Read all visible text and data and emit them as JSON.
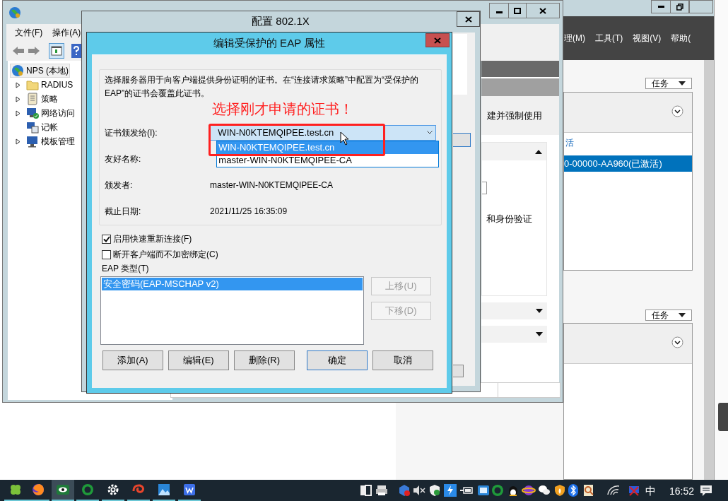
{
  "server_manager": {
    "menu": [
      "理(M)",
      "工具(T)",
      "视图(V)",
      "帮助("
    ],
    "tasks_buttons": [
      "任务",
      "任务"
    ],
    "link": "活",
    "selected_row": {
      "text": "0-00000-AA960(已激活)",
      "selected": true
    }
  },
  "nps_window": {
    "menu": [
      "文件(F)",
      "操作(A)"
    ],
    "tree": [
      {
        "label": "NPS (本地)",
        "selected": true,
        "children": [
          {
            "label": "RADIUS",
            "expandable": true,
            "selected": false
          },
          {
            "label": "策略",
            "expandable": true,
            "selected": false
          },
          {
            "label": "网络访问",
            "expandable": true,
            "selected": false
          },
          {
            "label": "记帐",
            "expandable": false,
            "selected": false
          },
          {
            "label": "模板管理",
            "expandable": true,
            "selected": false
          }
        ]
      }
    ],
    "fragments": [
      "建并强制使用",
      "和身份验证"
    ]
  },
  "dialog_8021x": {
    "title": "配置 802.1X"
  },
  "eap_dialog": {
    "title": "编辑受保护的 EAP 属性",
    "description": "选择服务器用于向客户端提供身份证明的证书。在“连接请求策略”中配置为“受保护的 EAP”的证书会覆盖此证书。",
    "annotation": "选择刚才申请的证书！",
    "certificate": {
      "label": "证书颁发给(I):",
      "value": "WIN-N0KTEMQIPEE.test.cn",
      "expanded": true,
      "options": [
        {
          "label": "WIN-N0KTEMQIPEE.test.cn",
          "selected": true
        },
        {
          "label": "master-WIN-N0KTEMQIPEE-CA",
          "selected": false
        }
      ]
    },
    "fields": [
      {
        "label": "友好名称:"
      },
      {
        "label": "颁发者:",
        "value": "master-WIN-N0KTEMQIPEE-CA"
      },
      {
        "label": "截止日期:",
        "value": "2021/11/25 16:35:09"
      }
    ],
    "checkboxes": [
      {
        "label": "启用快速重新连接(F)",
        "checked": true
      },
      {
        "label": "断开客户端而不加密绑定(C)",
        "checked": false
      }
    ],
    "eap_types_label": "EAP 类型(T)",
    "eap_types": [
      {
        "label": "安全密码(EAP-MSCHAP v2)",
        "selected": true
      }
    ],
    "side_buttons": [
      {
        "label": "上移(U)",
        "disabled": true
      },
      {
        "label": "下移(D)",
        "disabled": true
      }
    ],
    "buttons": [
      {
        "label": "添加(A)",
        "default": false
      },
      {
        "label": "编辑(E)",
        "default": false
      },
      {
        "label": "删除(R)",
        "default": false
      },
      {
        "label": "确定",
        "default": true
      },
      {
        "label": "取消",
        "default": false
      }
    ]
  },
  "taskbar": {
    "apps": [
      {
        "selected": false
      },
      {
        "selected": false
      },
      {
        "selected": true
      },
      {
        "selected": false
      },
      {
        "selected": false
      },
      {
        "selected": false
      },
      {
        "selected": false
      },
      {
        "selected": false
      }
    ],
    "ime": "中",
    "clock": "16:52"
  }
}
